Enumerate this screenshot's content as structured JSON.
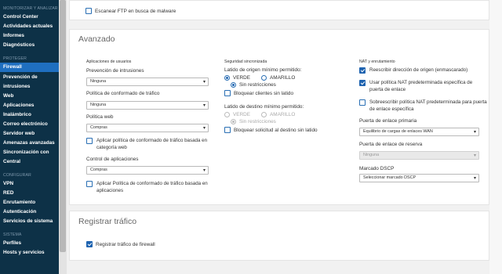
{
  "sidebar": {
    "sections": [
      {
        "title": "MONITORIZAR Y ANALIZAR",
        "items": [
          "Control Center",
          "Actividades actuales",
          "Informes",
          "Diagnósticos"
        ]
      },
      {
        "title": "PROTEGER",
        "items": [
          "Firewall",
          "Prevención de intrusiones",
          "Web",
          "Aplicaciones",
          "Inalámbrico",
          "Correo electrónico",
          "Servidor web",
          "Amenazas avanzadas",
          "Sincronización con Central"
        ]
      },
      {
        "title": "CONFIGURAR",
        "items": [
          "VPN",
          "RED",
          "Enrutamiento",
          "Autenticación",
          "Servicios de sistema"
        ]
      },
      {
        "title": "SISTEMA",
        "items": [
          "Perfiles",
          "Hosts y servicios"
        ]
      }
    ]
  },
  "top_card": {
    "scan_ftp_label": "Escanear FTP en busca de malware"
  },
  "avanzado": {
    "title": "Avanzado",
    "apps": {
      "heading": "Aplicaciones de usuarios",
      "ips_label": "Prevención de intrusiones",
      "ips_value": "Ninguna",
      "traffic_policy_label": "Política de conformado de tráfico",
      "traffic_policy_value": "Ninguna",
      "web_policy_label": "Política web",
      "web_policy_value": "Compras",
      "apply_web_cat_label": "Aplicar política de conformado de tráfico basada en categoría web",
      "app_control_label": "Control de aplicaciones",
      "app_control_value": "Compras",
      "apply_app_label": "Aplicar Política de conformado de tráfico basada en aplicaciones"
    },
    "heartbeat": {
      "heading": "Seguridad sincronizada",
      "source_label": "Latido de origen mínimo permitido:",
      "opt_green": "VERDE",
      "opt_yellow": "AMARILLO",
      "opt_none": "Sin restricciones",
      "block_no_hb": "Bloquear clientes sin latido",
      "dest_label": "Latido de destino mínimo permitido:",
      "block_dest": "Bloquear solicitud al destino sin latido"
    },
    "nat": {
      "heading": "NAT y enrutamiento",
      "rewrite_source": "Reescribir dirección de origen (enmascarado)",
      "default_nat_policy": "Usar política NAT predeterminada específica de puerta de enlace",
      "override_nat": "Sobreescribir política NAT predeterminada para puerta de enlace específica",
      "primary_gw_label": "Puerta de enlace primaria",
      "primary_gw_value": "Equilibrio de cargas de enlaces WAN",
      "backup_gw_label": "Puerta de enlace de reserva",
      "backup_gw_value": "Ninguna",
      "dscp_label": "Marcado DSCP",
      "dscp_value": "Seleccionar marcado DSCP"
    }
  },
  "logging": {
    "title": "Registrar tráfico",
    "log_fw_label": "Registrar tráfico de firewall"
  },
  "colors": {
    "sidebar_bg": "#0d3147",
    "active_item": "#1f6fc0",
    "accent": "#1e63b0"
  }
}
